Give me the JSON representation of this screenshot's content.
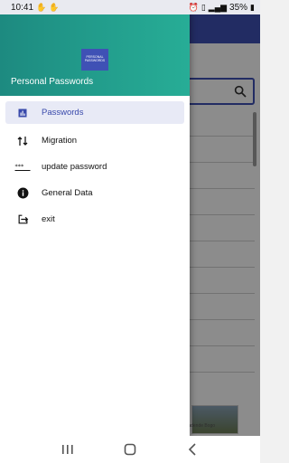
{
  "status_bar": {
    "time": "10:41",
    "battery": "35%",
    "left_icons": [
      "hand-icon",
      "hand-icon"
    ],
    "right_icons": [
      "alarm-icon",
      "vibrate-icon",
      "signal-icon",
      "battery-icon"
    ]
  },
  "drawer": {
    "logo_line1": "PERSONAL",
    "logo_line2": "PASSWORDS",
    "title": "Personal Passwords",
    "items": [
      {
        "label": "Passwords",
        "icon": "bar-chart-icon",
        "active": true
      },
      {
        "label": "Migration",
        "icon": "swap-vertical-icon",
        "active": false
      },
      {
        "label": "update password",
        "icon": "password-dots-icon",
        "active": false
      },
      {
        "label": "General Data",
        "icon": "info-icon",
        "active": false
      },
      {
        "label": "exit",
        "icon": "exit-icon",
        "active": false
      }
    ]
  },
  "background_ad_text": "ete adende Bogo",
  "colors": {
    "header_gradient_start": "#1d8a80",
    "header_gradient_end": "#27ad96",
    "accent": "#3f51b5",
    "active_item_bg": "#e8eaf6"
  }
}
